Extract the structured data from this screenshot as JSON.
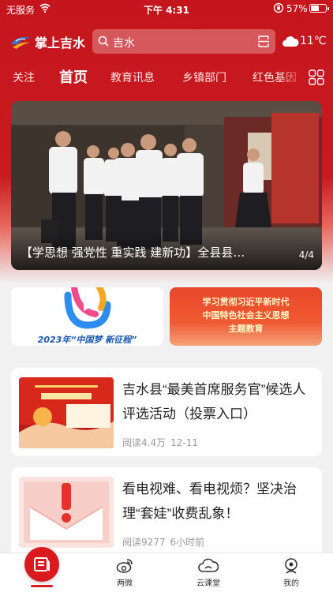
{
  "status_bar": {
    "carrier": "无服务",
    "time": "下午 4:31",
    "battery": "57%",
    "battery_level": 0.57
  },
  "header": {
    "logo_text": "掌上吉水",
    "search_value": "吉水",
    "weather_temp": "11℃",
    "weather_icon": "cloud-icon"
  },
  "tabs": [
    "关注",
    "首页",
    "教育讯息",
    "乡镇部门",
    "红色基因"
  ],
  "active_tab": "首页",
  "banner": {
    "caption": "【学思想 强党性 重实践 建新功】全县县…",
    "page": "4/4"
  },
  "promos": {
    "left_text": "2023年“中国梦 新征程”",
    "right_lines": [
      "学习贯彻习近平新时代",
      "中国特色社会主义思想",
      "主题教育"
    ]
  },
  "articles": [
    {
      "title": "吉水县“最美首席服务官”候选人评选活动（投票入口）",
      "reads": "阅读4.4万",
      "time": "12-11"
    },
    {
      "title": "看电视难、看电视烦？坚决治理“套娃”收费乱象！",
      "reads": "阅读9277",
      "time": "6小时前"
    }
  ],
  "tabbar": {
    "items": [
      "两微",
      "云课堂",
      "我的"
    ]
  },
  "colors": {
    "brand_red": "#c5161d",
    "accent_red": "#d91a1f"
  }
}
